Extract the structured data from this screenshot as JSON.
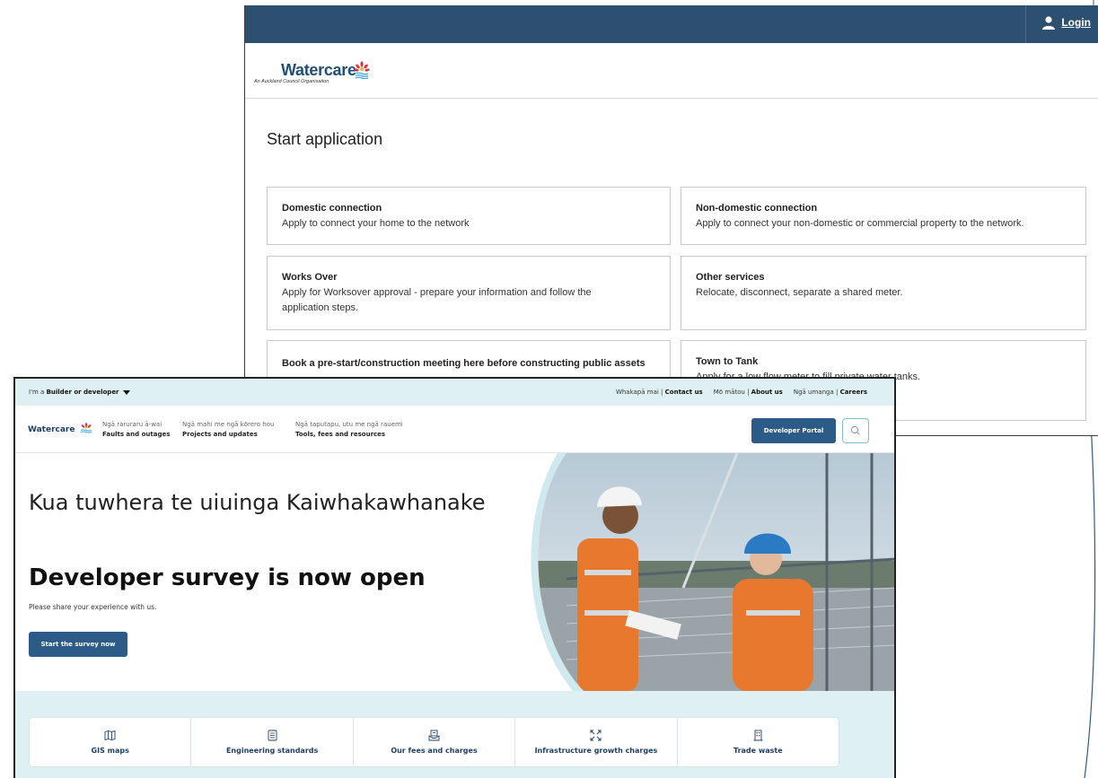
{
  "portal": {
    "login_label": "Login",
    "logo": {
      "wordmark": "Watercare",
      "tagline": "An Auckland Council Organisation"
    },
    "page_title": "Start application",
    "cards": [
      {
        "title": "Domestic connection",
        "desc": "Apply to connect your home to the network"
      },
      {
        "title": "Non-domestic connection",
        "desc": "Apply to connect your non-domestic or commercial property to the network."
      },
      {
        "title": "Works Over",
        "desc": "Apply for Worksover approval - prepare your information and follow the application steps."
      },
      {
        "title": "Other services",
        "desc": "Relocate, disconnect, separate a shared meter."
      },
      {
        "title": "Book a pre-start/construction meeting here before constructing public assets",
        "desc": ""
      },
      {
        "title": "Town to Tank",
        "desc": "Apply for a low flow meter to fill private water tanks."
      }
    ]
  },
  "site": {
    "utility": {
      "iam_prefix": "I'm a",
      "iam_value": "Builder or developer",
      "contact_mi": "Whakapā mai |",
      "contact_en": "Contact us",
      "about_mi": "Mō mātou |",
      "about_en": "About us",
      "careers_mi": "Ngā umanga |",
      "careers_en": "Careers"
    },
    "logo": "Watercare",
    "nav": [
      {
        "mi": "Ngā raruraru ā-wai",
        "en": "Faults and outages"
      },
      {
        "mi": "Ngā mahi me ngā kōrero hou",
        "en": "Projects and updates"
      },
      {
        "mi": "Ngā taputapu, utu me ngā rauemi",
        "en": "Tools, fees and resources"
      }
    ],
    "developer_portal_label": "Developer Portal",
    "hero": {
      "heading_mi": "Kua tuwhera te uiuinga Kaiwhakawhanake",
      "heading_en": "Developer survey is now open",
      "text": "Please share your experience with us.",
      "button": "Start the survey now"
    },
    "quick_links": [
      {
        "label": "GIS maps",
        "icon": "map-icon"
      },
      {
        "label": "Engineering standards",
        "icon": "document-icon"
      },
      {
        "label": "Our fees and charges",
        "icon": "fees-icon"
      },
      {
        "label": "Infrastructure growth charges",
        "icon": "expand-icon"
      },
      {
        "label": "Trade waste",
        "icon": "building-icon"
      }
    ]
  },
  "colors": {
    "portal_topbar": "#2d5070",
    "brand_blue": "#2b5b86",
    "band_teal": "#dff0f2"
  }
}
